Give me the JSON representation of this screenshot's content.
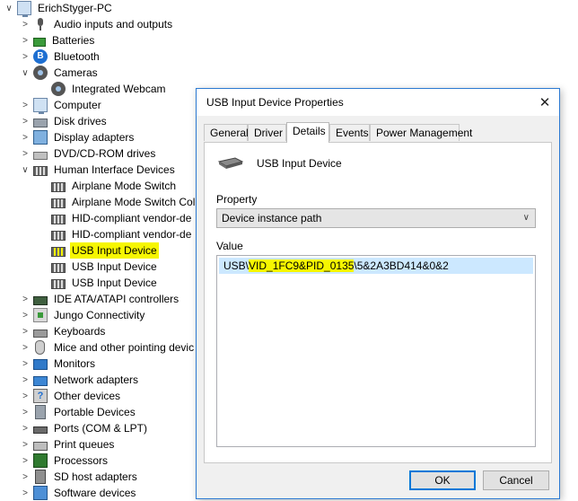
{
  "tree": {
    "root": "ErichStyger-PC",
    "items": [
      {
        "label": "Audio inputs and outputs",
        "icon": "speaker-icon"
      },
      {
        "label": "Batteries",
        "icon": "battery-icon"
      },
      {
        "label": "Bluetooth",
        "icon": "bluetooth-icon"
      },
      {
        "label": "Cameras",
        "icon": "camera-icon"
      },
      {
        "label": "Integrated Webcam",
        "icon": "webcam-icon"
      },
      {
        "label": "Computer",
        "icon": "computer-icon"
      },
      {
        "label": "Disk drives",
        "icon": "disk-drive-icon"
      },
      {
        "label": "Display adapters",
        "icon": "display-adapter-icon"
      },
      {
        "label": "DVD/CD-ROM drives",
        "icon": "dvd-drive-icon"
      },
      {
        "label": "Human Interface Devices",
        "icon": "hid-icon"
      },
      {
        "label": "Airplane Mode Switch",
        "icon": "hid-device-icon"
      },
      {
        "label": "Airplane Mode Switch Col",
        "icon": "hid-device-icon"
      },
      {
        "label": "HID-compliant vendor-de",
        "icon": "hid-device-icon"
      },
      {
        "label": "HID-compliant vendor-de",
        "icon": "hid-device-icon"
      },
      {
        "label": "USB Input Device",
        "icon": "hid-device-icon"
      },
      {
        "label": "USB Input Device",
        "icon": "hid-device-icon"
      },
      {
        "label": "USB Input Device",
        "icon": "hid-device-icon"
      },
      {
        "label": "IDE ATA/ATAPI controllers",
        "icon": "ide-controller-icon"
      },
      {
        "label": "Jungo Connectivity",
        "icon": "jungo-icon"
      },
      {
        "label": "Keyboards",
        "icon": "keyboard-icon"
      },
      {
        "label": "Mice and other pointing devic",
        "icon": "mouse-icon"
      },
      {
        "label": "Monitors",
        "icon": "monitor-icon"
      },
      {
        "label": "Network adapters",
        "icon": "network-adapter-icon"
      },
      {
        "label": "Other devices",
        "icon": "other-devices-icon"
      },
      {
        "label": "Portable Devices",
        "icon": "portable-device-icon"
      },
      {
        "label": "Ports (COM & LPT)",
        "icon": "ports-icon"
      },
      {
        "label": "Print queues",
        "icon": "printer-icon"
      },
      {
        "label": "Processors",
        "icon": "processor-icon"
      },
      {
        "label": "SD host adapters",
        "icon": "sd-card-icon"
      },
      {
        "label": "Software devices",
        "icon": "software-device-icon"
      }
    ]
  },
  "dialog": {
    "title": "USB Input Device Properties",
    "tabs": [
      "General",
      "Driver",
      "Details",
      "Events",
      "Power Management"
    ],
    "active_tab": "Details",
    "device_name": "USB Input Device",
    "property_label": "Property",
    "property_selected": "Device instance path",
    "value_label": "Value",
    "value": {
      "prefix": "USB\\",
      "highlighted": "VID_1FC9&PID_0135",
      "suffix": "\\5&2A3BD414&0&2"
    },
    "ok_label": "OK",
    "cancel_label": "Cancel"
  },
  "colors": {
    "highlight": "#f6f600",
    "selection": "#cce8ff",
    "accent": "#0078d7"
  }
}
